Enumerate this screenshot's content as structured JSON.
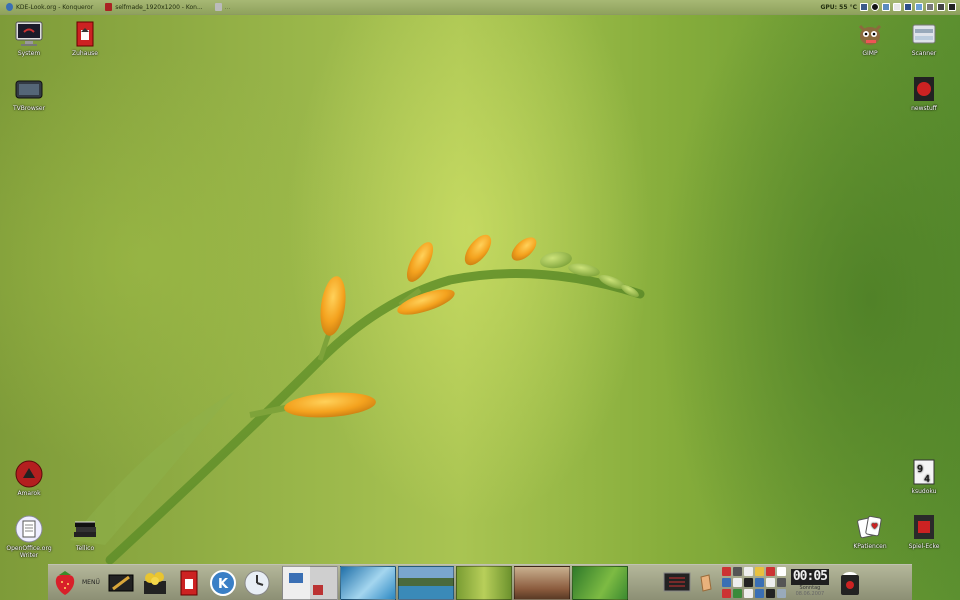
{
  "top_taskbar": {
    "tasks": [
      {
        "label": "KDE-Look.org - Konqueror",
        "icon": "globe-icon"
      },
      {
        "label": "selfmade_1920x1200 - Kon...",
        "icon": "image-icon"
      },
      {
        "label": "...",
        "icon": "window-icon"
      }
    ],
    "gpu_label": "GPU: 55 °C"
  },
  "desktop_icons": {
    "system": "System",
    "zuhause": "Zuhause",
    "tvbrowser": "TVBrowser",
    "gimp": "GIMP",
    "scanner": "Scanner",
    "newstuff": "newstuff",
    "amarok": "Amarok",
    "openoffice": "OpenOffice.org Writer",
    "tellico": "Tellico",
    "ksudoku": "ksudoku",
    "kpatience": "KPatiencen",
    "spiel_ecke": "Spiel-Ecke"
  },
  "panel": {
    "menu_label": "MENÜ",
    "clock_time": "00:05",
    "clock_day": "Sonntag",
    "clock_date": "08.06.2007"
  },
  "colors": {
    "panel": "#a2a586",
    "wallpaper_green": "#98b549",
    "bud_orange": "#f4a21e"
  }
}
